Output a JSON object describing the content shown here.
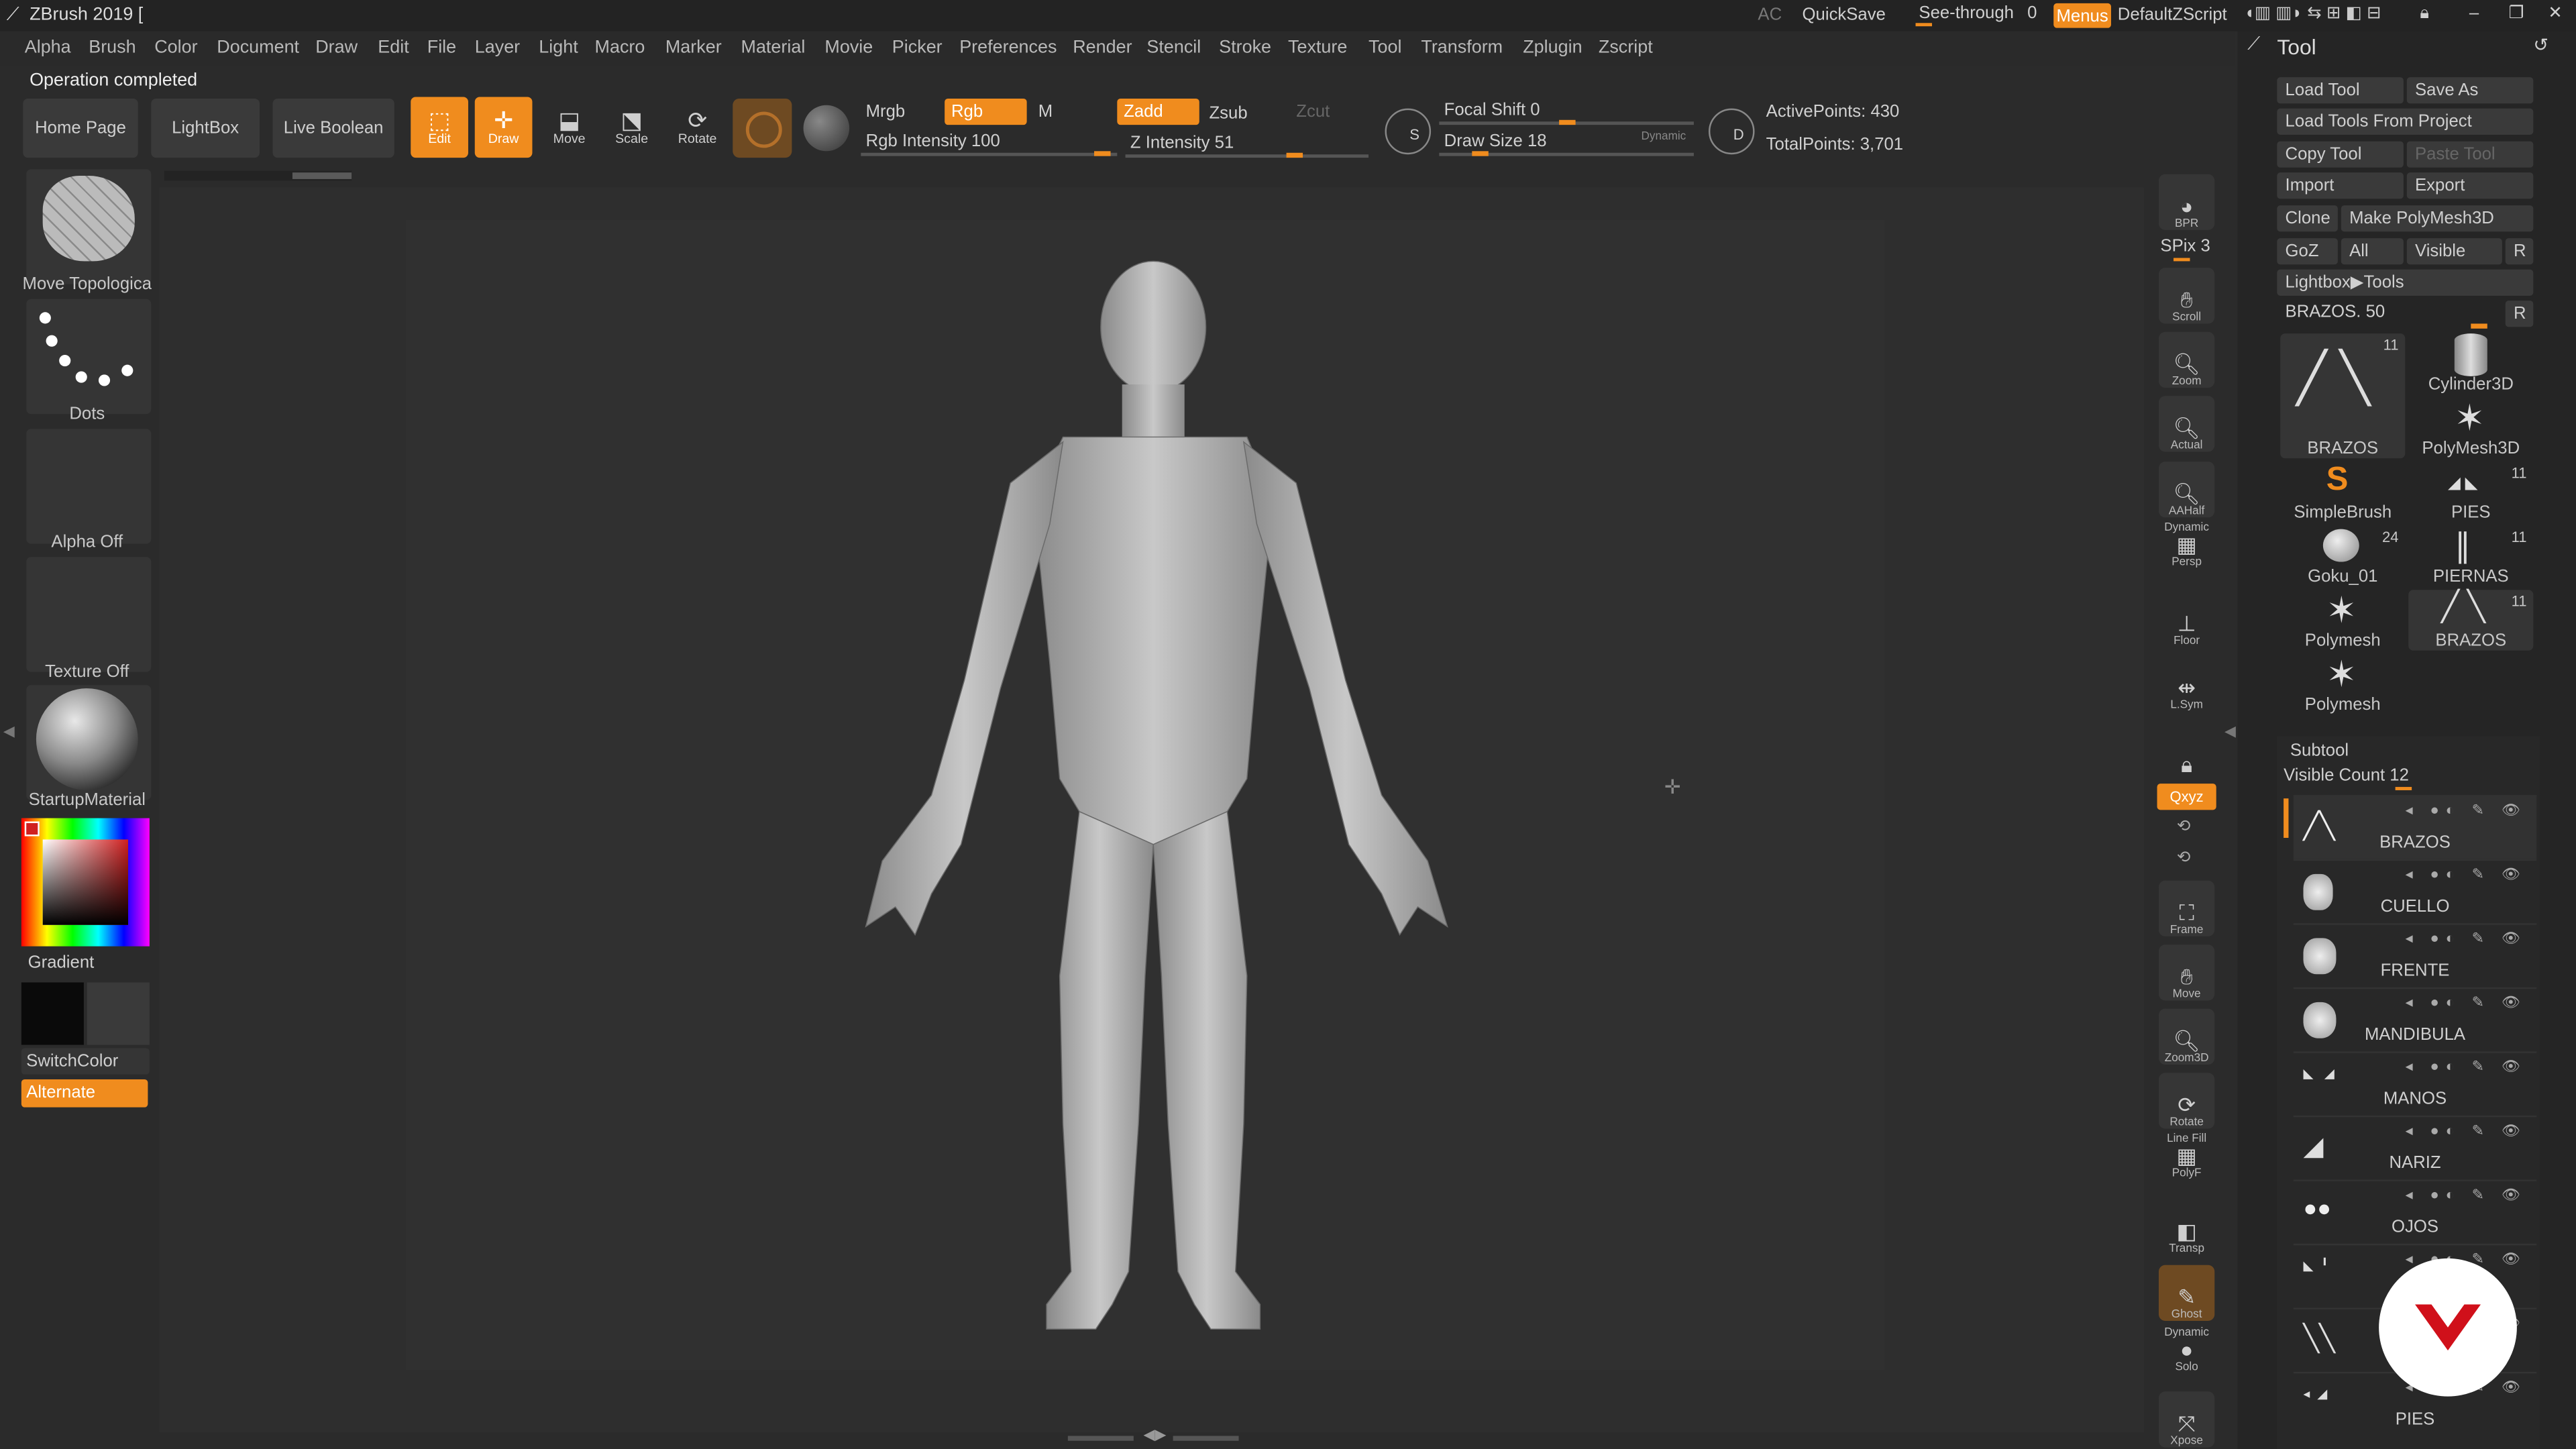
{
  "app": {
    "title": "ZBrush 2019 [",
    "ac": "AC",
    "quicksave": "QuickSave",
    "see_through": "See-through",
    "see_through_value": "0",
    "menus": "Menus",
    "script": "DefaultZScript"
  },
  "menu": [
    "Alpha",
    "Brush",
    "Color",
    "Document",
    "Draw",
    "Edit",
    "File",
    "Layer",
    "Light",
    "Macro",
    "Marker",
    "Material",
    "Movie",
    "Picker",
    "Preferences",
    "Render",
    "Stencil",
    "Stroke",
    "Texture",
    "Tool",
    "Transform",
    "Zplugin",
    "Zscript"
  ],
  "status": "Operation completed",
  "toolbar": {
    "home_page": "Home Page",
    "lightbox": "LightBox",
    "live_boolean": "Live Boolean",
    "edit": "Edit",
    "draw": "Draw",
    "move": "Move",
    "scale": "Scale",
    "rotate": "Rotate",
    "mrgb": "Mrgb",
    "rgb": "Rgb",
    "m": "M",
    "zadd": "Zadd",
    "zsub": "Zsub",
    "zcut": "Zcut",
    "rgb_intensity": "Rgb Intensity 100",
    "z_intensity": "Z Intensity 51",
    "focal_shift": "Focal Shift 0",
    "draw_size": "Draw Size 18",
    "dynamic": "Dynamic",
    "active_points": "ActivePoints: 430",
    "total_points": "TotalPoints: 3,701"
  },
  "left": {
    "brush": "Move Topologica",
    "stroke": "Dots",
    "alpha": "Alpha Off",
    "texture": "Texture Off",
    "material": "StartupMaterial",
    "gradient": "Gradient",
    "switch_color": "SwitchColor",
    "alternate": "Alternate"
  },
  "right_shelf": {
    "bpr": "BPR",
    "spix": "SPix 3",
    "scroll": "Scroll",
    "zoom": "Zoom",
    "actual": "Actual",
    "aahalf": "AAHalf",
    "persp_top": "Dynamic",
    "persp": "Persp",
    "floor": "Floor",
    "lsym": "L.Sym",
    "xyz": "Qxyz",
    "frame": "Frame",
    "move": "Move",
    "zoom3d": "Zoom3D",
    "rotate": "Rotate",
    "polyf_top": "Line Fill",
    "polyf": "PolyF",
    "transp": "Transp",
    "ghost": "Ghost",
    "solo_top": "Dynamic",
    "solo": "Solo",
    "xpose": "Xpose"
  },
  "tool_panel": {
    "title": "Tool",
    "load_tool": "Load Tool",
    "save_as": "Save As",
    "load_from_project": "Load Tools From Project",
    "copy_tool": "Copy Tool",
    "paste_tool": "Paste Tool",
    "import": "Import",
    "export": "Export",
    "clone": "Clone",
    "make_polymesh": "Make PolyMesh3D",
    "goz": "GoZ",
    "all": "All",
    "visible": "Visible",
    "r": "R",
    "lightbox_tools": "Lightbox▶Tools",
    "current": "BRAZOS. 50",
    "r2": "R",
    "items": [
      {
        "label": "BRAZOS",
        "count": "11"
      },
      {
        "label": "Cylinder3D",
        "count": ""
      },
      {
        "label": "PolyMesh3D",
        "count": ""
      },
      {
        "label": "SimpleBrush",
        "count": ""
      },
      {
        "label": "PIES",
        "count": "11"
      },
      {
        "label": "Goku_01",
        "count": "24"
      },
      {
        "label": "PIERNAS",
        "count": "11"
      },
      {
        "label": "Polymesh",
        "count": ""
      },
      {
        "label": "BRAZOS",
        "count": "11"
      },
      {
        "label": "Polymesh",
        "count": ""
      }
    ],
    "subtool": "Subtool",
    "visible_count": "Visible Count 12",
    "subtools": [
      "BRAZOS",
      "CUELLO",
      "FRENTE",
      "MANDIBULA",
      "MANOS",
      "NARIZ",
      "OJOS",
      "",
      "PIES"
    ]
  },
  "colors": {
    "accent": "#f08c1e",
    "bg": "#2b2b2b",
    "canvas": "#2e2e2e"
  }
}
